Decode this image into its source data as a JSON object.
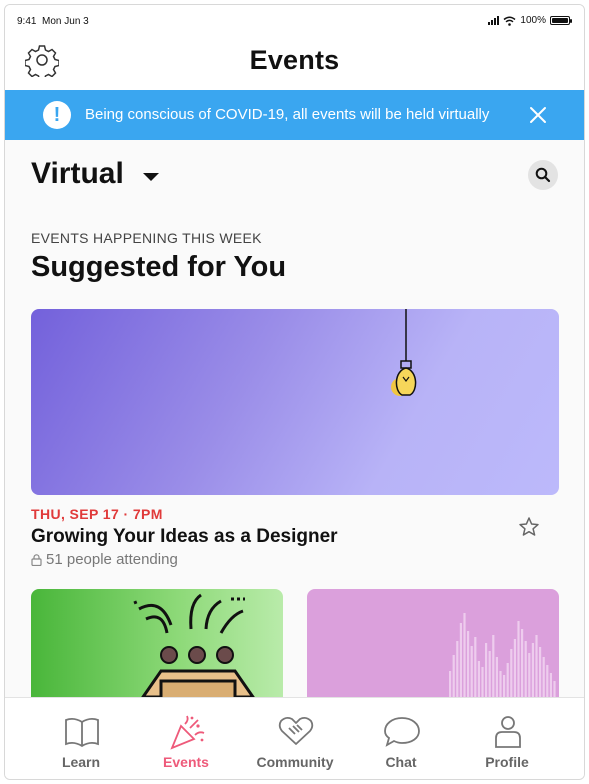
{
  "status_bar": {
    "time": "9:41",
    "date": "Mon Jun 3",
    "battery": "100%"
  },
  "header": {
    "title": "Events",
    "settings_icon": "gear-icon"
  },
  "banner": {
    "message": "Being conscious of COVID-19, all events will be held virtually",
    "color": "#3aa6f0"
  },
  "location": {
    "selected": "Virtual"
  },
  "section": {
    "overline": "EVENTS HAPPENING THIS WEEK",
    "title": "Suggested for You"
  },
  "featured_event": {
    "date": "THU, SEP 17 · 7PM",
    "title": "Growing Your Ideas as a Designer",
    "attending": "51 people attending"
  },
  "tabs": [
    {
      "label": "Learn",
      "icon": "book-icon",
      "active": false
    },
    {
      "label": "Events",
      "icon": "party-popper-icon",
      "active": true
    },
    {
      "label": "Community",
      "icon": "handshake-icon",
      "active": false
    },
    {
      "label": "Chat",
      "icon": "chat-bubble-icon",
      "active": false
    },
    {
      "label": "Profile",
      "icon": "person-icon",
      "active": false
    }
  ],
  "colors": {
    "accent": "#ee5a7a",
    "date_red": "#e03a3a"
  }
}
